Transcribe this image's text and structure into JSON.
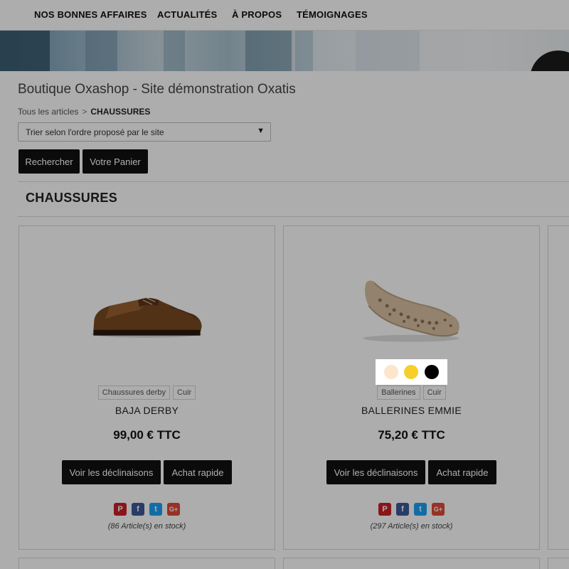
{
  "nav": {
    "items": [
      {
        "label": "NOS BONNES AFFAIRES"
      },
      {
        "label": "ACTUALITÉS"
      },
      {
        "label": "À PROPOS"
      },
      {
        "label": "TÉMOIGNAGES"
      }
    ]
  },
  "shop_title": "Boutique Oxashop - Site démonstration Oxatis",
  "breadcrumb": {
    "root": "Tous les articles",
    "separator": ">",
    "current": "CHAUSSURES"
  },
  "sort": {
    "selected": "Trier selon l'ordre proposé par le site",
    "arrow": "▼"
  },
  "actions": {
    "search_label": "Rechercher",
    "cart_label": "Votre Panier"
  },
  "category_title": "CHAUSSURES",
  "products": [
    {
      "tags": [
        "Chaussures derby",
        "Cuir"
      ],
      "name": "BAJA DERBY",
      "price": "99,00 € TTC",
      "variants_label": "Voir les déclinaisons",
      "quick_buy_label": "Achat rapide",
      "stock": "(86 Article(s) en stock)"
    },
    {
      "tags": [
        "Ballerines",
        "Cuir"
      ],
      "name": "BALLERINES EMMIE",
      "price": "75,20 € TTC",
      "variants_label": "Voir les déclinaisons",
      "quick_buy_label": "Achat rapide",
      "stock": "(297 Article(s) en stock)",
      "swatches": [
        "#fde6cc",
        "#f6cf2b",
        "#000000"
      ]
    }
  ],
  "social_icons": [
    {
      "name": "pinterest-icon",
      "glyph": "P",
      "color": "#cb2027"
    },
    {
      "name": "facebook-icon",
      "glyph": "f",
      "color": "#3b5998"
    },
    {
      "name": "twitter-icon",
      "glyph": "t",
      "color": "#1da1f2"
    },
    {
      "name": "google-plus-icon",
      "glyph": "G+",
      "color": "#dd4b39"
    }
  ]
}
